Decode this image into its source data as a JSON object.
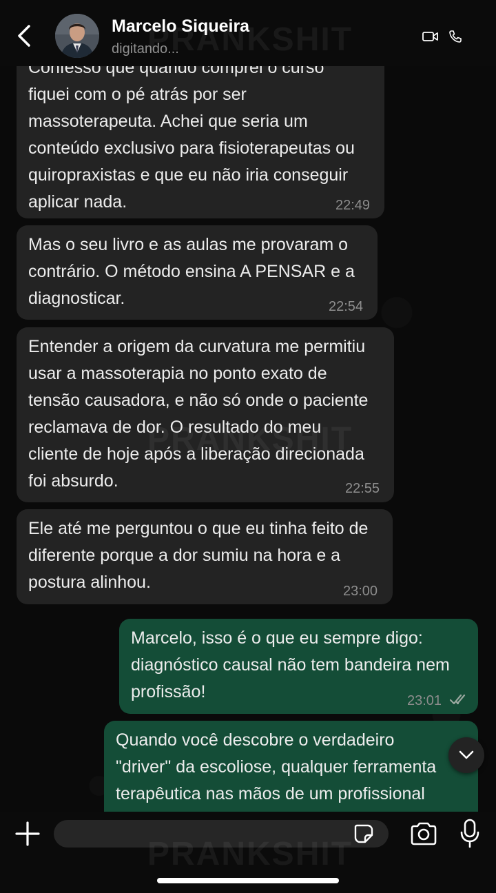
{
  "contact": {
    "name": "Marcelo Siqueira",
    "status": "digitando..."
  },
  "watermark": "PRANKSHIT",
  "messages": [
    {
      "direction": "incoming",
      "text": "Confesso que quando comprei o curso\nfiquei com o pé atrás por ser\nmassoterapeuta. Achei que seria um\nconteúdo exclusivo para fisioterapeutas ou\nquiropraxistas e que eu não iria conseguir\naplicar nada.",
      "time": "22:49"
    },
    {
      "direction": "incoming",
      "text": "Mas o seu livro e as aulas me provaram o\ncontrário. O método ensina A PENSAR e a\ndiagnosticar.",
      "time": "22:54"
    },
    {
      "direction": "incoming",
      "text": "Entender a origem da curvatura me permitiu\nusar a massoterapia no ponto exato de\ntensão causadora, e não só onde o paciente\nreclamava de dor. O resultado do meu\ncliente de hoje após a liberação direcionada\nfoi absurdo.",
      "time": "22:55"
    },
    {
      "direction": "incoming",
      "text": "Ele até me perguntou o que eu tinha feito de\ndiferente porque a dor sumiu na hora e a\npostura alinhou.",
      "time": "23:00"
    },
    {
      "direction": "outgoing",
      "text": "Marcelo, isso é o que eu sempre digo:\ndiagnóstico causal não tem bandeira nem\nprofissão!",
      "time": "23:01",
      "read": true
    },
    {
      "direction": "outgoing",
      "text": "Quando você descobre o verdadeiro\n\"driver\" da escoliose, qualquer ferramenta\nterapêutica nas mãos de um profissional",
      "time": ""
    }
  ],
  "input": {
    "placeholder": "",
    "value": ""
  },
  "colors": {
    "incoming_bubble": "#232323",
    "outgoing_bubble": "#144d37",
    "background": "#0a0a0a",
    "read_ticks": "#8d8d8d"
  },
  "icons": [
    "back-icon",
    "video-call-icon",
    "phone-icon",
    "chevron-down-icon",
    "plus-icon",
    "sticker-icon",
    "camera-icon",
    "mic-icon",
    "double-check-icon"
  ]
}
